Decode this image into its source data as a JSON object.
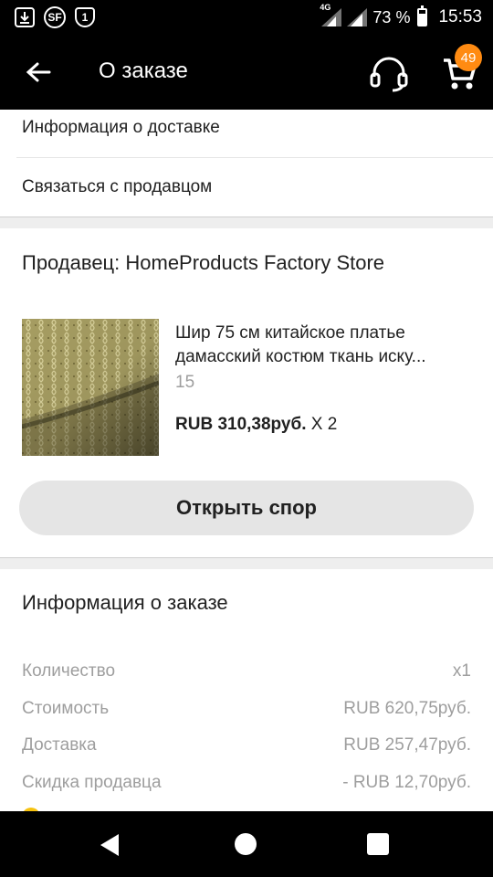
{
  "status_bar": {
    "network_type": "4G",
    "battery_percent": "73 %",
    "battery_level": 0.73,
    "time": "15:53",
    "left_icons": [
      "download-icon",
      "sf-icon",
      "sim-1-icon"
    ],
    "sf_label": "SF",
    "sim_label": "1"
  },
  "app_bar": {
    "title": "О заказе",
    "cart_badge": "49",
    "icons": [
      "back-arrow-icon",
      "headset-icon",
      "cart-icon"
    ]
  },
  "links": {
    "delivery_info": "Информация о доставке",
    "contact_seller": "Связаться с продавцом"
  },
  "seller": {
    "label": "Продавец: HomeProducts Factory Store"
  },
  "product": {
    "title_line1": "Шир 75 см китайское платье",
    "title_line2": "дамасский костюм ткань иску...",
    "sku": "15",
    "price": "RUB 310,38руб.",
    "quantity": "X 2"
  },
  "dispute_button": "Открыть спор",
  "order_info": {
    "title": "Информация о заказе",
    "rows": [
      {
        "label": "Количество",
        "value": "x1"
      },
      {
        "label": "Стоимость",
        "value": "RUB 620,75руб."
      },
      {
        "label": "Доставка",
        "value": "RUB 257,47руб."
      },
      {
        "label": "Скидка продавца",
        "value": "- RUB 12,70руб."
      }
    ]
  },
  "colors": {
    "badge": "#ff8b12",
    "button_bg": "#e5e5e5",
    "muted_text": "#9e9e9e"
  }
}
